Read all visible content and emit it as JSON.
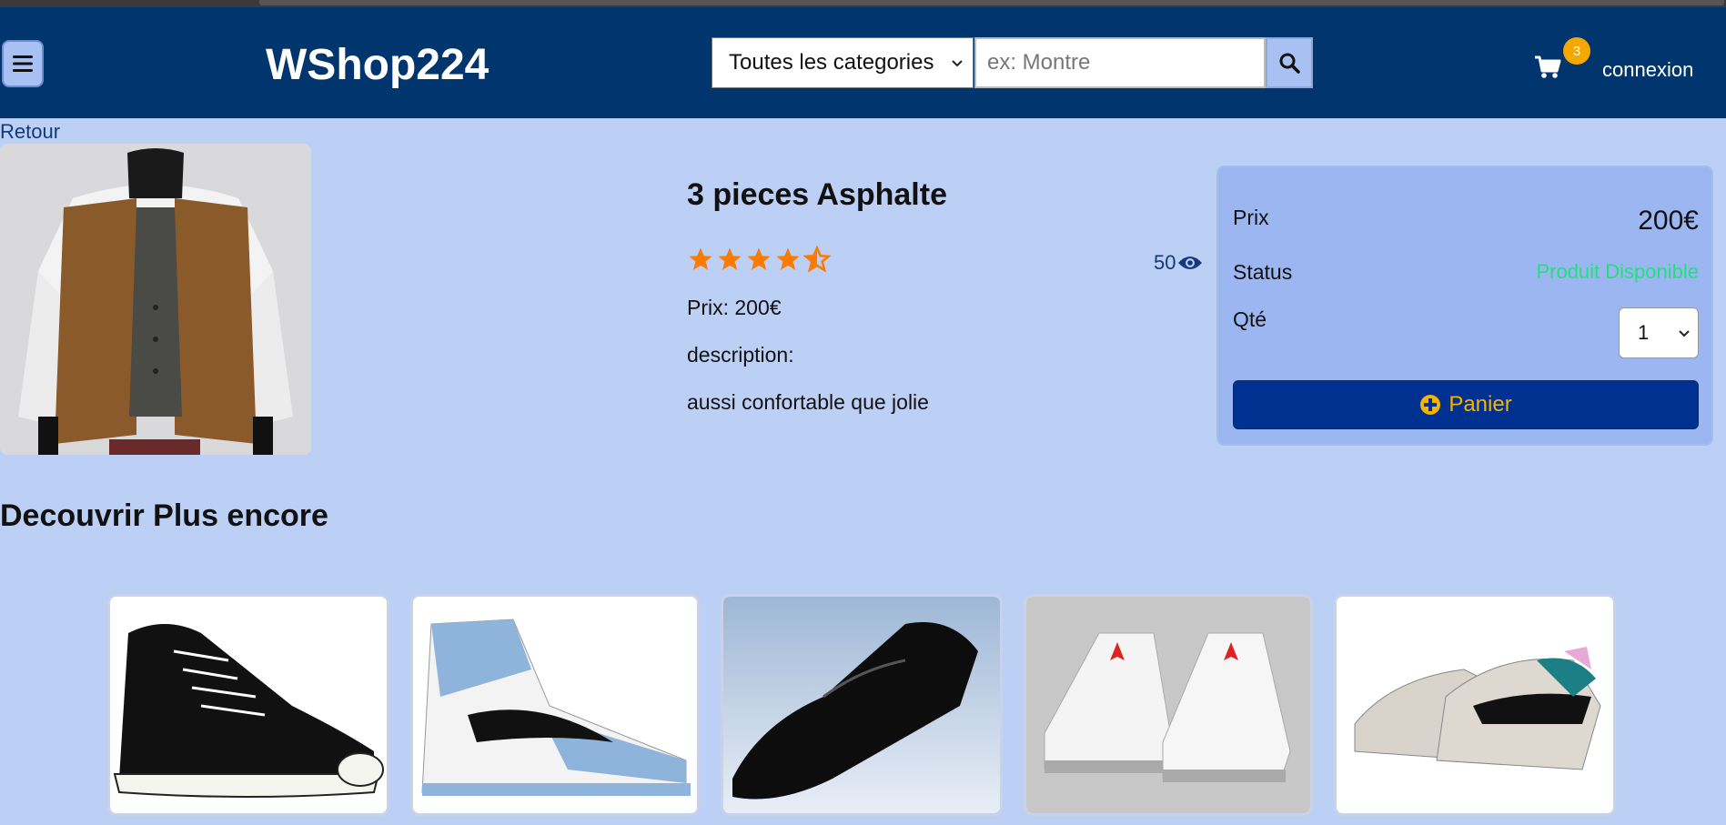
{
  "header": {
    "logo": "WShop224",
    "category_select": "Toutes les categories",
    "search_placeholder": "ex: Montre",
    "cart_count": "3",
    "login": "connexion"
  },
  "back_link": "Retour",
  "product": {
    "title": "3 pieces Asphalte",
    "rating": 4.5,
    "views": "50",
    "price_line": "Prix: 200€",
    "description_label": "description:",
    "description": "aussi confortable que jolie"
  },
  "purchase_panel": {
    "price_label": "Prix",
    "price": "200€",
    "status_label": "Status",
    "status": "Produit Disponible",
    "qty_label": "Qté",
    "qty": "1",
    "add_button": "Panier"
  },
  "section_title": "Decouvrir Plus encore",
  "colors": {
    "header_bg": "#00356e",
    "page_bg": "#bccff5",
    "panel_bg": "#9bb6f0",
    "button_bg": "#003090",
    "accent": "#f5a800",
    "star": "#ff7a00",
    "available": "#23e07a"
  }
}
